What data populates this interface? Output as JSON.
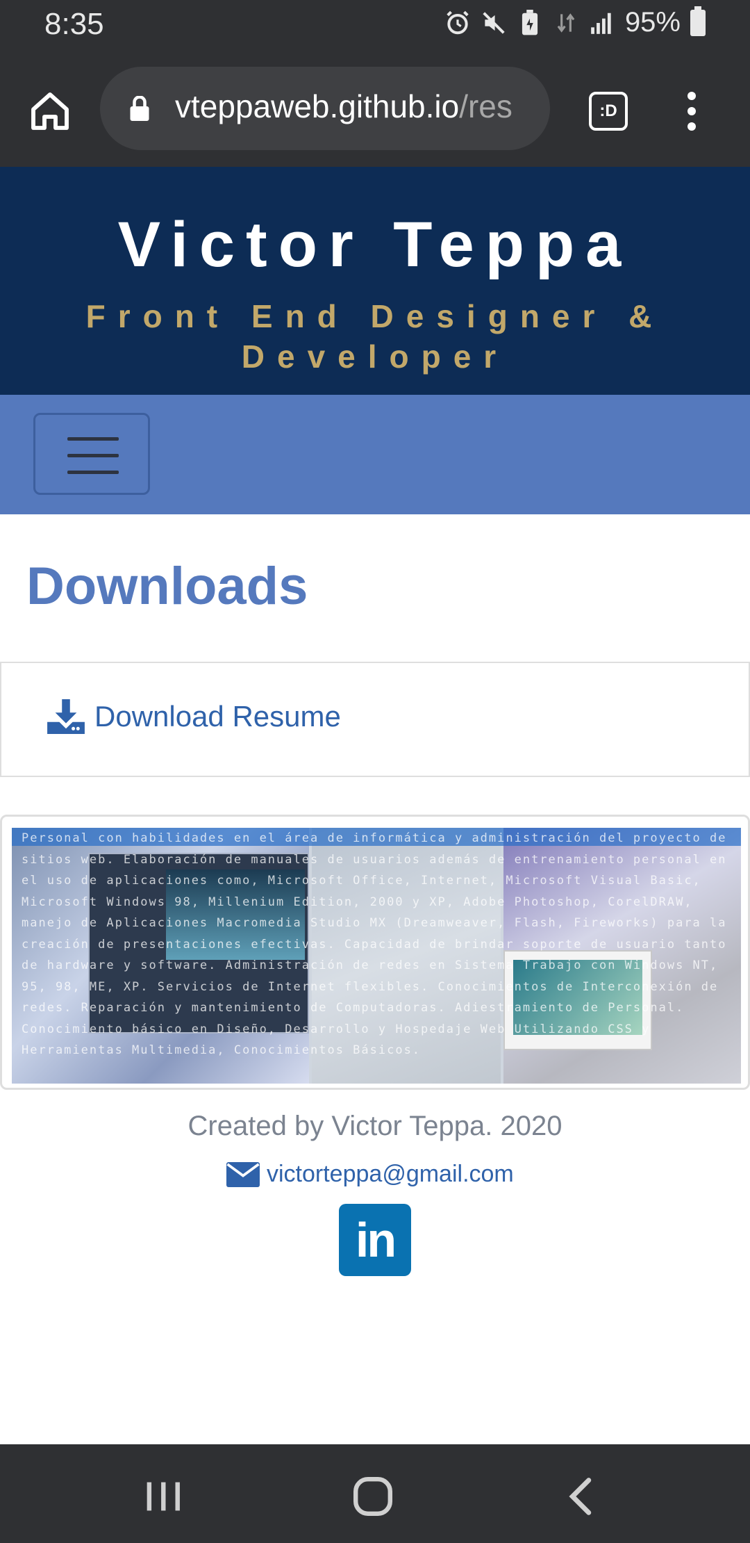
{
  "status_bar": {
    "time": "8:35",
    "battery": "95%",
    "icons": [
      "alarm-icon",
      "mute-icon",
      "battery-saver-icon",
      "data-icon",
      "signal-icon",
      "battery-icon"
    ]
  },
  "browser": {
    "url_domain": "vteppaweb.github.io",
    "url_path": "/res",
    "tab_button_label": ":D"
  },
  "header": {
    "name": "Victor Teppa",
    "role": "Front End Designer & Developer"
  },
  "main": {
    "title": "Downloads",
    "download_label": "Download Resume",
    "banner_text": "Personal con habilidades en el área de informática y administración del proyecto de sitios web. Elaboración de manuales de usuarios además de entrenamiento personal en el uso de aplicaciones como, Microsoft Office, Internet, Microsoft Visual Basic, Microsoft Windows 98, Millenium Edition, 2000 y XP, Adobe Photoshop, CorelDRAW, manejo de Aplicaciones Macromedia Studio MX (Dreamweaver, Flash, Fireworks) para la creación de presentaciones efectivas. Capacidad de brindar soporte de usuario tanto de hardware y software. Administración de redes en Sistema Trabajo con Windows NT, 95, 98, ME, XP. Servicios de Internet flexibles. Conocimientos de Interconexión de redes. Reparación y mantenimiento de Computadoras. Adiestramiento de Personal. Conocimiento básico en Diseño, Desarrollo y Hospedaje Web Utilizando CSS y Herramientas Multimedia, Conocimientos Básicos."
  },
  "footer": {
    "created": "Created by Victor Teppa. 2020",
    "email": "victorteppa@gmail.com",
    "linkedin_label": "in"
  },
  "colors": {
    "header_bg": "#0d2c55",
    "accent_gold": "#c2a86a",
    "nav_bg": "#5579bd",
    "link": "#2f62aa",
    "linkedin": "#0a72b1"
  }
}
